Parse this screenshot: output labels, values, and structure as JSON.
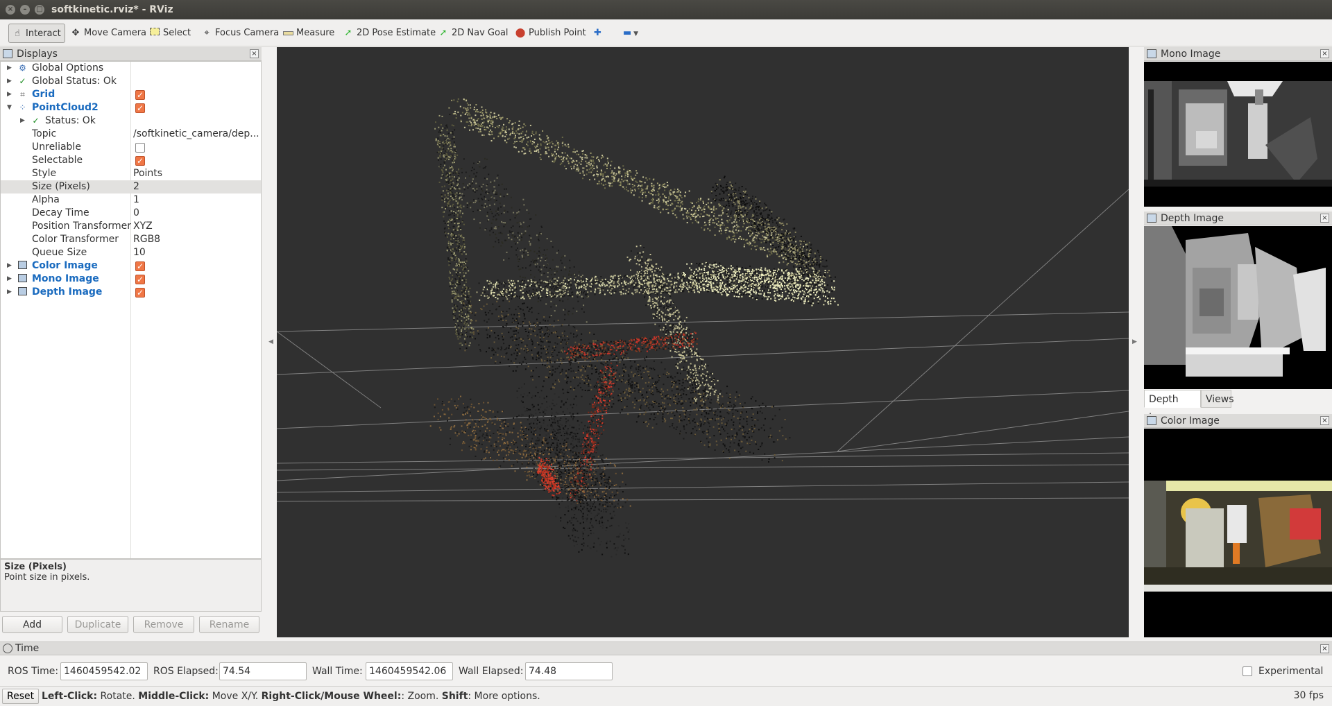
{
  "window": {
    "title": "softkinetic.rviz* - RViz"
  },
  "toolbar": {
    "tools": [
      {
        "label": "Interact",
        "icon": "hand-icon"
      },
      {
        "label": "Move Camera",
        "icon": "move-camera-icon"
      },
      {
        "label": "Select",
        "icon": "select-icon"
      },
      {
        "label": "Focus Camera",
        "icon": "focus-camera-icon"
      },
      {
        "label": "Measure",
        "icon": "ruler-icon"
      },
      {
        "label": "2D Pose Estimate",
        "icon": "pose-arrow-icon"
      },
      {
        "label": "2D Nav Goal",
        "icon": "nav-goal-icon"
      },
      {
        "label": "Publish Point",
        "icon": "map-pin-icon"
      }
    ]
  },
  "displays": {
    "title": "Displays",
    "tree": [
      {
        "name": "Global Options"
      },
      {
        "name": "Global Status: Ok"
      },
      {
        "name": "Grid"
      },
      {
        "name": "PointCloud2"
      },
      {
        "name": "Status: Ok"
      },
      {
        "name": "Topic",
        "value": "/softkinetic_camera/dep..."
      },
      {
        "name": "Unreliable"
      },
      {
        "name": "Selectable"
      },
      {
        "name": "Style",
        "value": "Points"
      },
      {
        "name": "Size (Pixels)",
        "value": "2"
      },
      {
        "name": "Alpha",
        "value": "1"
      },
      {
        "name": "Decay Time",
        "value": "0"
      },
      {
        "name": "Position Transformer",
        "value": "XYZ"
      },
      {
        "name": "Color Transformer",
        "value": "RGB8"
      },
      {
        "name": "Queue Size",
        "value": "10"
      },
      {
        "name": "Color Image"
      },
      {
        "name": "Mono Image"
      },
      {
        "name": "Depth Image"
      }
    ],
    "description_title": "Size (Pixels)",
    "description_text": "Point size in pixels.",
    "buttons": {
      "add": "Add",
      "duplicate": "Duplicate",
      "remove": "Remove",
      "rename": "Rename"
    }
  },
  "panels": {
    "mono": "Mono Image",
    "depth": "Depth Image",
    "color": "Color Image",
    "tabs": [
      "Depth Image",
      "Views"
    ]
  },
  "time": {
    "title": "Time",
    "ros_time_label": "ROS Time:",
    "ros_time": "1460459542.02",
    "ros_elapsed_label": "ROS Elapsed:",
    "ros_elapsed": "74.54",
    "wall_time_label": "Wall Time:",
    "wall_time": "1460459542.06",
    "wall_elapsed_label": "Wall Elapsed:",
    "wall_elapsed": "74.48",
    "experimental": "Experimental"
  },
  "status": {
    "reset": "Reset",
    "k1": "Left-Click:",
    "t1": " Rotate. ",
    "k2": "Middle-Click:",
    "t2": " Move X/Y. ",
    "k3": "Right-Click/Mouse Wheel:",
    "t3": ": Zoom. ",
    "k4": "Shift",
    "t4": ": More options.",
    "fps": "30 fps"
  },
  "colors": {
    "accent": "#1a6bbf",
    "checkbox": "#f07746",
    "viewport_bg": "#303030"
  }
}
